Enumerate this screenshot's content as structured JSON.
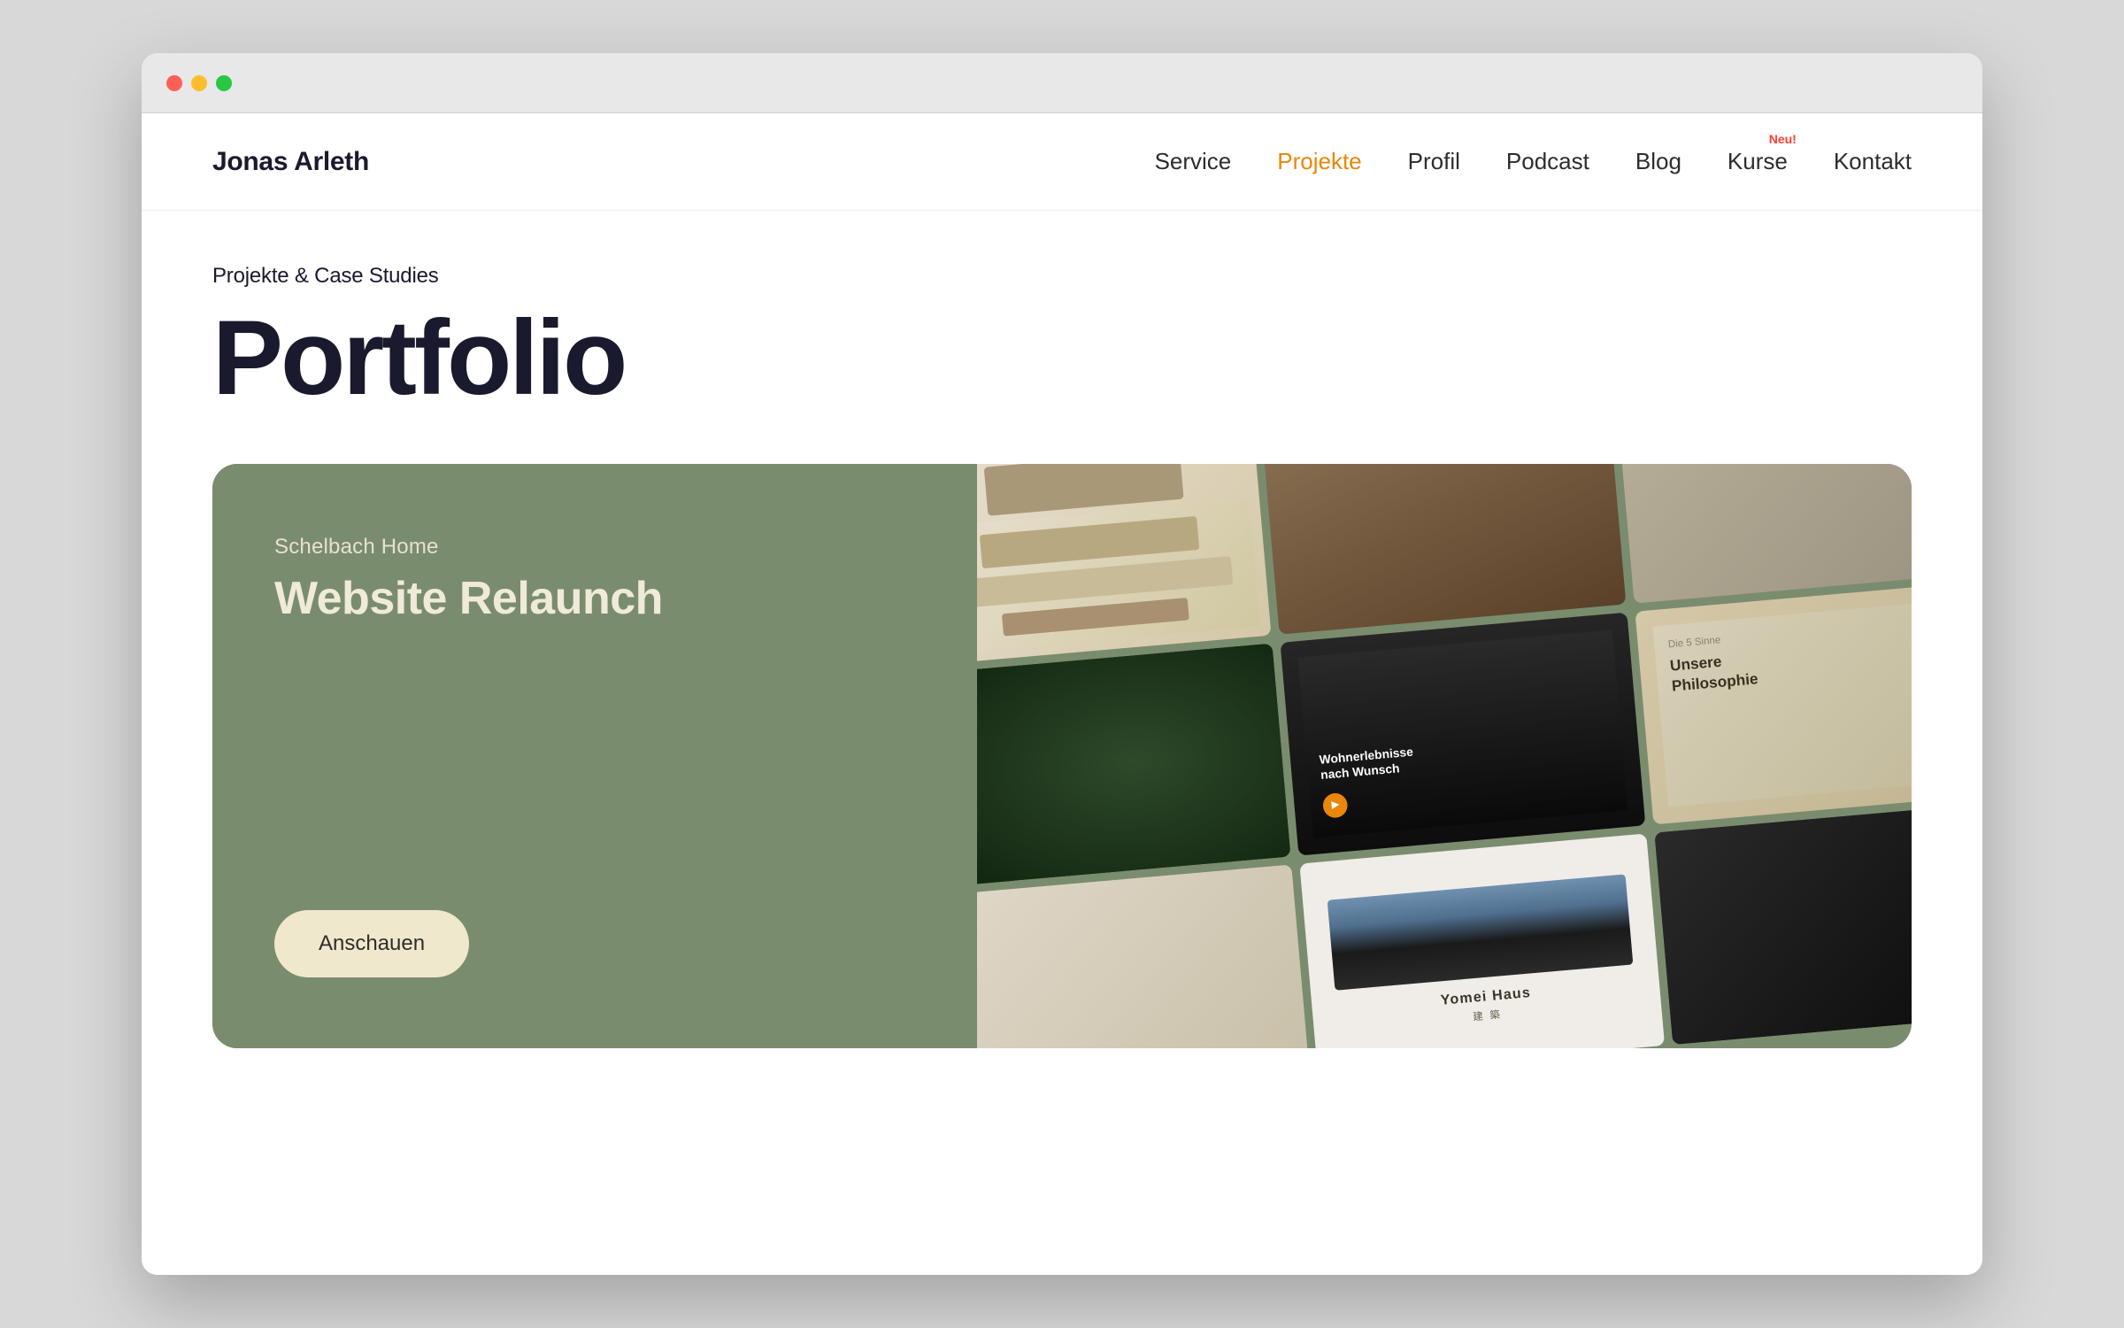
{
  "browser": {
    "traffic_lights": [
      "red",
      "yellow",
      "green"
    ]
  },
  "nav": {
    "logo": "Jonas Arleth",
    "links": [
      {
        "id": "service",
        "label": "Service",
        "active": false
      },
      {
        "id": "projekte",
        "label": "Projekte",
        "active": true
      },
      {
        "id": "profil",
        "label": "Profil",
        "active": false
      },
      {
        "id": "podcast",
        "label": "Podcast",
        "active": false
      },
      {
        "id": "blog",
        "label": "Blog",
        "active": false
      },
      {
        "id": "kurse",
        "label": "Kurse",
        "active": false,
        "badge": "Neu!"
      },
      {
        "id": "kontakt",
        "label": "Kontakt",
        "active": false
      }
    ]
  },
  "page": {
    "subtitle": "Projekte & Case Studies",
    "title": "Portfolio"
  },
  "card": {
    "project_name": "Schelbach Home",
    "project_title": "Website Relaunch",
    "button_label": "Anschauen",
    "mosaic": {
      "item5_text_line1": "Wohnerlebnisse",
      "item5_text_line2": "nach Wunsch",
      "item6_text": "Die 5 Sinne\nUnsere\nPhilosophie",
      "item8_name": "Yomei Haus",
      "item8_sub": "建 築"
    }
  },
  "colors": {
    "accent_orange": "#e8870a",
    "badge_red": "#ff3b30",
    "nav_dark": "#1a1a2e",
    "card_bg": "#7a8c6e",
    "card_text_light": "#f0ead8",
    "button_bg": "#f0e8cc"
  }
}
